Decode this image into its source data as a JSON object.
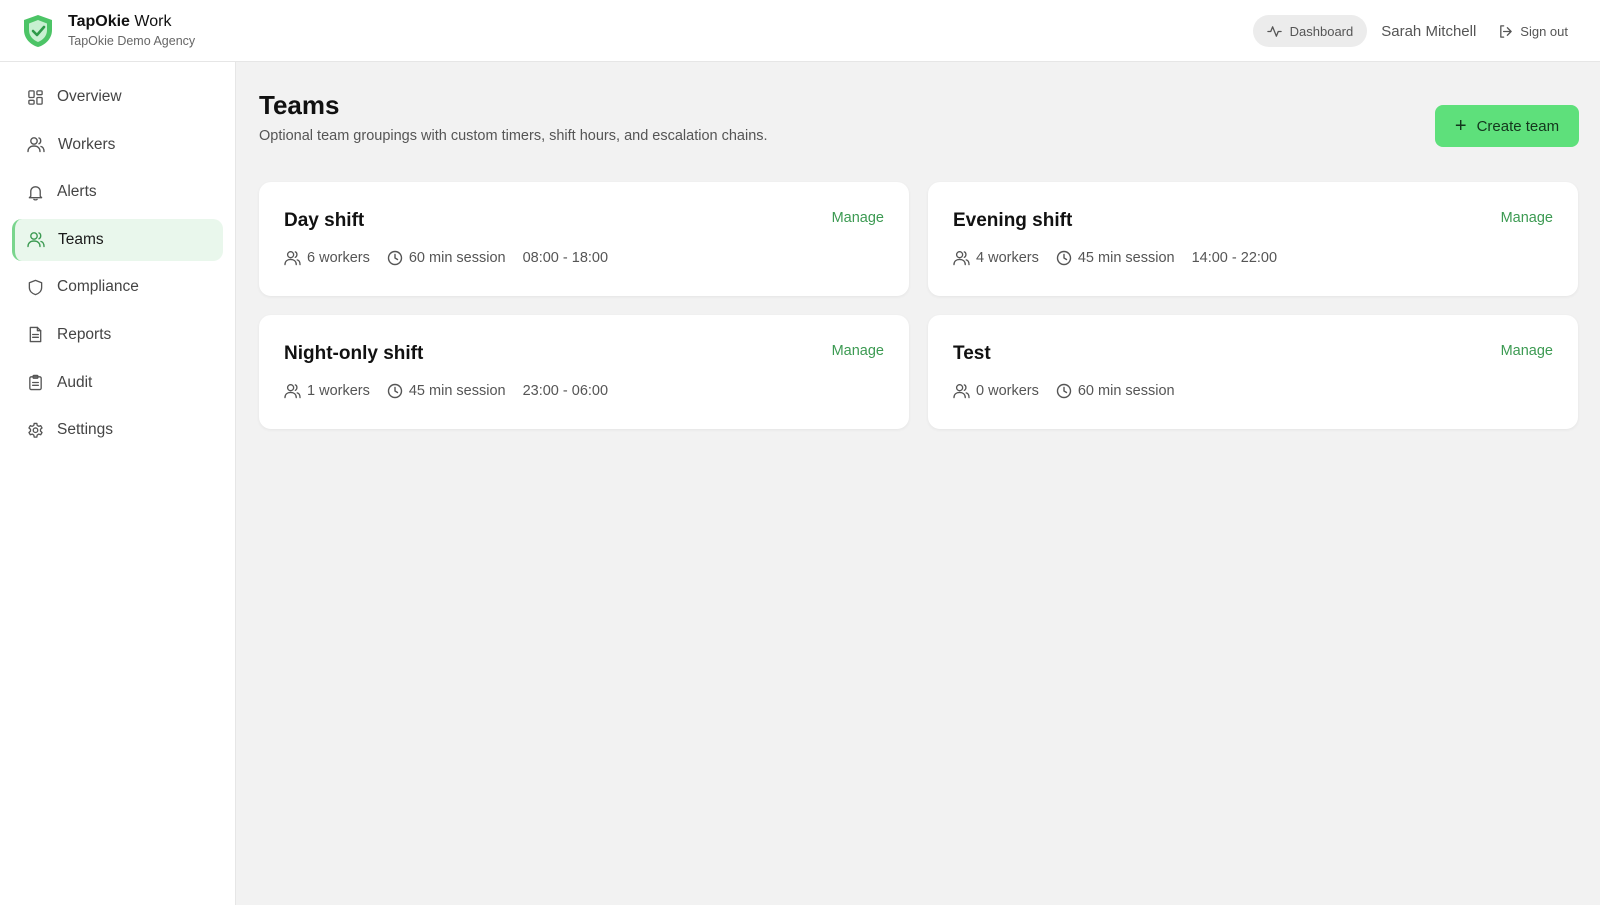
{
  "brand": {
    "title_bold": "TapOkie",
    "title_rest": "Work",
    "subtitle": "TapOkie Demo Agency",
    "accent": "#4cc466"
  },
  "header": {
    "dashboard_label": "Dashboard",
    "user_name": "Sarah Mitchell",
    "signout_label": "Sign out"
  },
  "sidebar": {
    "items": [
      {
        "label": "Overview",
        "icon": "grid-icon",
        "active": false
      },
      {
        "label": "Workers",
        "icon": "users-icon",
        "active": false
      },
      {
        "label": "Alerts",
        "icon": "bell-icon",
        "active": false
      },
      {
        "label": "Teams",
        "icon": "users-icon",
        "active": true
      },
      {
        "label": "Compliance",
        "icon": "shield-icon",
        "active": false
      },
      {
        "label": "Reports",
        "icon": "file-text-icon",
        "active": false
      },
      {
        "label": "Audit",
        "icon": "clipboard-icon",
        "active": false
      },
      {
        "label": "Settings",
        "icon": "gear-icon",
        "active": false
      }
    ]
  },
  "page": {
    "title": "Teams",
    "subtitle": "Optional team groupings with custom timers, shift hours, and escalation chains.",
    "create_label": "Create team"
  },
  "teams": [
    {
      "name": "Day shift",
      "manage": "Manage",
      "workers": "6 workers",
      "session": "60 min session",
      "hours": "08:00 - 18:00"
    },
    {
      "name": "Evening shift",
      "manage": "Manage",
      "workers": "4 workers",
      "session": "45 min session",
      "hours": "14:00 - 22:00"
    },
    {
      "name": "Night-only shift",
      "manage": "Manage",
      "workers": "1 workers",
      "session": "45 min session",
      "hours": "23:00 - 06:00"
    },
    {
      "name": "Test",
      "manage": "Manage",
      "workers": "0 workers",
      "session": "60 min session",
      "hours": ""
    }
  ],
  "colors": {
    "primary_button": "#5ee07b",
    "link": "#3c9a52",
    "active_nav_bg": "#e9f7ec"
  }
}
